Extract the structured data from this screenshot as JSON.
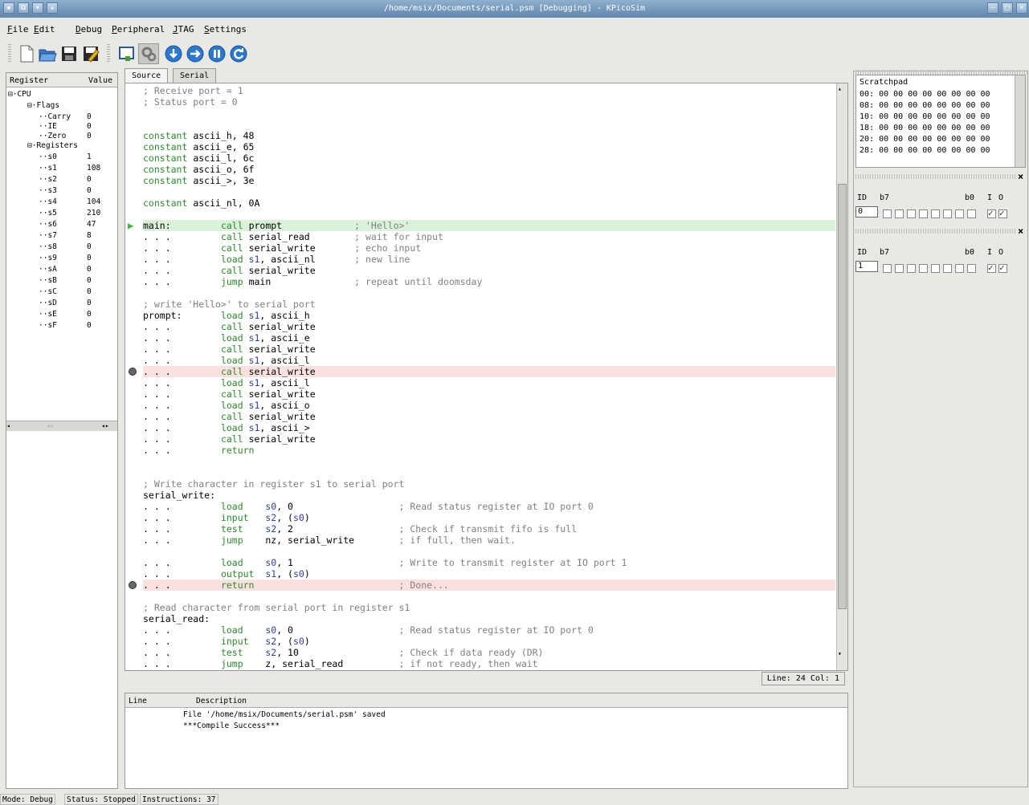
{
  "window": {
    "title": "/home/msix/Documents/serial.psm [Debugging] - KPicoSim"
  },
  "menu": [
    {
      "u": "F",
      "rest": "ile"
    },
    {
      "u": "E",
      "rest": "dit"
    },
    {
      "u": "D",
      "rest": "ebug"
    },
    {
      "u": "P",
      "rest": "eripheral"
    },
    {
      "u": "J",
      "rest": "TAG"
    },
    {
      "u": "S",
      "rest": "ettings"
    }
  ],
  "toolbar": {
    "icons": [
      "new-file-icon",
      "open-folder-icon",
      "save-icon",
      "save-as-icon",
      "download-icon",
      "debug-gear-icon",
      "step-icon",
      "run-icon",
      "pause-icon",
      "reset-icon"
    ]
  },
  "registers": {
    "header_register": "Register",
    "header_value": "Value",
    "root": "CPU",
    "flags_label": "Flags",
    "flags": [
      {
        "name": "Carry",
        "value": "0"
      },
      {
        "name": "IE",
        "value": "0"
      },
      {
        "name": "Zero",
        "value": "0"
      }
    ],
    "registers_label": "Registers",
    "regs": [
      {
        "name": "s0",
        "value": "1"
      },
      {
        "name": "s1",
        "value": "108"
      },
      {
        "name": "s2",
        "value": "0"
      },
      {
        "name": "s3",
        "value": "0"
      },
      {
        "name": "s4",
        "value": "104"
      },
      {
        "name": "s5",
        "value": "210"
      },
      {
        "name": "s6",
        "value": "47"
      },
      {
        "name": "s7",
        "value": "8"
      },
      {
        "name": "s8",
        "value": "0"
      },
      {
        "name": "s9",
        "value": "0"
      },
      {
        "name": "sA",
        "value": "0"
      },
      {
        "name": "sB",
        "value": "0"
      },
      {
        "name": "sC",
        "value": "0"
      },
      {
        "name": "sD",
        "value": "0"
      },
      {
        "name": "sE",
        "value": "0"
      },
      {
        "name": "sF",
        "value": "0"
      }
    ]
  },
  "tabs": [
    {
      "label": "Source",
      "active": true
    },
    {
      "label": "Serial",
      "active": false
    }
  ],
  "source": [
    {
      "t": "; Receive port = 1",
      "k": "com"
    },
    {
      "t": "; Status port = 0",
      "k": "com"
    },
    {
      "t": "",
      "k": ""
    },
    {
      "t": "",
      "k": ""
    },
    {
      "t": "constant|ascii_h, 48",
      "k": "const"
    },
    {
      "t": "constant|ascii_e, 65",
      "k": "const"
    },
    {
      "t": "constant|ascii_l, 6c",
      "k": "const"
    },
    {
      "t": "constant|ascii_o, 6f",
      "k": "const"
    },
    {
      "t": "constant|ascii_>, 3e",
      "k": "const"
    },
    {
      "t": "",
      "k": ""
    },
    {
      "t": "constant|ascii_nl, 0A",
      "k": "const"
    },
    {
      "t": "",
      "k": ""
    },
    {
      "t": "main:|call|prompt|; 'Hello>'",
      "k": "instr",
      "hl": "green",
      "marker": "arrow"
    },
    {
      "t": "|call|serial_read|; wait for input",
      "k": "instr"
    },
    {
      "t": "|call|serial_write|; echo input",
      "k": "instr"
    },
    {
      "t": "|load|s1, ascii_nl|; new line",
      "k": "instr"
    },
    {
      "t": "|call|serial_write|",
      "k": "instr"
    },
    {
      "t": "|jump|main|; repeat until doomsday",
      "k": "instr"
    },
    {
      "t": "",
      "k": ""
    },
    {
      "t": "; write 'Hello>' to serial port",
      "k": "com"
    },
    {
      "t": "prompt:|load|s1, ascii_h|",
      "k": "instr"
    },
    {
      "t": "|call|serial_write|",
      "k": "instr"
    },
    {
      "t": "|load|s1, ascii_e|",
      "k": "instr"
    },
    {
      "t": "|call|serial_write|",
      "k": "instr"
    },
    {
      "t": "|load|s1, ascii_l|",
      "k": "instr"
    },
    {
      "t": "|call|serial_write|",
      "k": "instr",
      "hl": "red",
      "marker": "bp"
    },
    {
      "t": "|load|s1, ascii_l|",
      "k": "instr"
    },
    {
      "t": "|call|serial_write|",
      "k": "instr"
    },
    {
      "t": "|load|s1, ascii_o|",
      "k": "instr"
    },
    {
      "t": "|call|serial_write|",
      "k": "instr"
    },
    {
      "t": "|load|s1, ascii_>|",
      "k": "instr"
    },
    {
      "t": "|call|serial_write|",
      "k": "instr"
    },
    {
      "t": "|return||",
      "k": "instr"
    },
    {
      "t": "",
      "k": ""
    },
    {
      "t": "",
      "k": ""
    },
    {
      "t": "; Write character in register s1 to serial port",
      "k": "com"
    },
    {
      "t": "serial_write:",
      "k": "label"
    },
    {
      "t": "|load|s0, 0|; Read status register at IO port 0",
      "k": "instr2"
    },
    {
      "t": "|input|s2, (s0)|",
      "k": "instr2"
    },
    {
      "t": "|test|s2, 2|; Check if transmit fifo is full",
      "k": "instr2"
    },
    {
      "t": "|jump|nz, serial_write|; if full, then wait.",
      "k": "instr2"
    },
    {
      "t": "",
      "k": ""
    },
    {
      "t": "|load|s0, 1|; Write to transmit register at IO port 1",
      "k": "instr2"
    },
    {
      "t": "|output|s1, (s0)|",
      "k": "instr2"
    },
    {
      "t": "|return||; Done...",
      "k": "instr2",
      "hl": "red",
      "marker": "bp"
    },
    {
      "t": "",
      "k": ""
    },
    {
      "t": "; Read character from serial port in register s1",
      "k": "com"
    },
    {
      "t": "serial_read:",
      "k": "label"
    },
    {
      "t": "|load|s0, 0|; Read status register at IO port 0",
      "k": "instr2"
    },
    {
      "t": "|input|s2, (s0)|",
      "k": "instr2"
    },
    {
      "t": "|test|s2, 10|; Check if data ready (DR)",
      "k": "instr2"
    },
    {
      "t": "|jump|z, serial_read|; if not ready, then wait",
      "k": "instr2"
    }
  ],
  "cursor": {
    "label": "Line: 24 Col: 1"
  },
  "output": {
    "header_line": "Line",
    "header_desc": "Description",
    "messages": [
      "File '/home/msix/Documents/serial.psm' saved",
      "***Compile Success***"
    ]
  },
  "scratchpad": {
    "title": "Scratchpad",
    "rows": [
      "00: 00 00 00 00 00 00 00 00",
      "08: 00 00 00 00 00 00 00 00",
      "10: 00 00 00 00 00 00 00 00",
      "18: 00 00 00 00 00 00 00 00",
      "20: 00 00 00 00 00 00 00 00",
      "28: 00 00 00 00 00 00 00 00"
    ]
  },
  "ports": [
    {
      "id_label": "ID",
      "b7": "b7",
      "b0": "b0",
      "i": "I",
      "o": "O",
      "id": "0",
      "bits": [
        0,
        0,
        0,
        0,
        0,
        0,
        0,
        0
      ],
      "in": true,
      "out": true
    },
    {
      "id_label": "ID",
      "b7": "b7",
      "b0": "b0",
      "i": "I",
      "o": "O",
      "id": "1",
      "bits": [
        0,
        0,
        0,
        0,
        0,
        0,
        0,
        0
      ],
      "in": true,
      "out": true
    }
  ],
  "statusbar": {
    "mode": "Mode: Debug",
    "status": "Status: Stopped",
    "instructions": "Instructions: 37"
  },
  "colors": {
    "titlebar": "#6f94bb",
    "current_line": "#d9f2d9",
    "breakpoint_line": "#fbe0e0",
    "keyword": "#2a8a2a",
    "comment": "#808080"
  }
}
